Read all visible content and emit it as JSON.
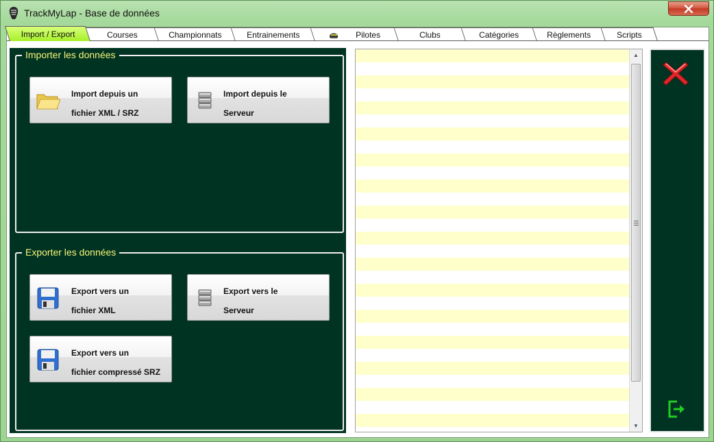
{
  "window": {
    "title": "TrackMyLap - Base de données",
    "close_icon": "close-icon"
  },
  "tabs": [
    {
      "label": "Import / Export",
      "active": true
    },
    {
      "label": "Courses",
      "active": false
    },
    {
      "label": "Championnats",
      "active": false
    },
    {
      "label": "Entrainements",
      "active": false
    },
    {
      "label": "Pilotes",
      "active": false,
      "icon": "helmet-icon"
    },
    {
      "label": "Clubs",
      "active": false
    },
    {
      "label": "Catégories",
      "active": false
    },
    {
      "label": "Règlements",
      "active": false
    },
    {
      "label": "Scripts",
      "active": false
    }
  ],
  "import_group": {
    "legend": "Importer les données",
    "buttons": [
      {
        "line1": "Import depuis un",
        "line2": "fichier XML / SRZ",
        "icon": "folder-icon"
      },
      {
        "line1": "Import depuis le",
        "line2": "Serveur",
        "icon": "database-icon"
      }
    ]
  },
  "export_group": {
    "legend": "Exporter les données",
    "buttons": [
      {
        "line1": "Export vers un",
        "line2": "fichier XML",
        "icon": "floppy-disk-icon"
      },
      {
        "line1": "Export vers le",
        "line2": "Serveur",
        "icon": "database-icon"
      },
      {
        "line1": "Export vers un",
        "line2": "fichier compressé SRZ",
        "icon": "floppy-disk-icon"
      }
    ]
  },
  "side_panel": {
    "cancel_icon": "red-x-icon",
    "exit_icon": "exit-icon"
  },
  "colors": {
    "panel_bg": "#003321",
    "legend_text": "#f5f57a",
    "active_tab": "#a6f02a",
    "stripe": "#ffffcc"
  }
}
